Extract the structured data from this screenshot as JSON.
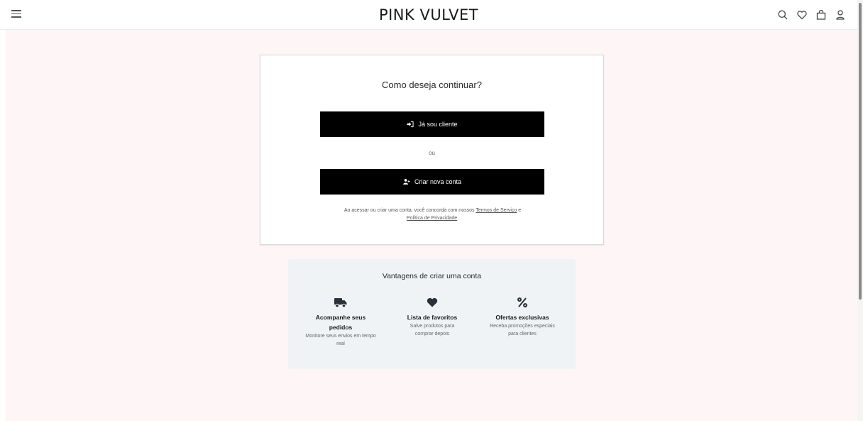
{
  "header": {
    "brand": "PINK VULVET",
    "icons": [
      "menu-icon",
      "search-icon",
      "heart-icon",
      "bag-icon",
      "user-icon"
    ]
  },
  "card": {
    "title": "Como deseja continuar?",
    "login_label": "Já sou cliente",
    "or_text": "ou",
    "create_label": "Criar nova conta",
    "terms_prefix": "Ao acessar ou criar uma conta, você concorda com nossos",
    "terms_link": "Termos de Serviço",
    "terms_and": "e",
    "privacy_link": "Política de Privacidade",
    "terms_end": "."
  },
  "benefits": {
    "title": "Vantagens de criar uma conta",
    "items": [
      {
        "icon": "truck-icon",
        "title": "Acompanhe seus pedidos",
        "desc": "Monitore seus envios em tempo real"
      },
      {
        "icon": "heart-filled-icon",
        "title": "Lista de favoritos",
        "desc": "Salve produtos para comprar depois"
      },
      {
        "icon": "percent-icon",
        "title": "Ofertas exclusivas",
        "desc": "Receba promoções especiais para clientes"
      }
    ]
  },
  "colors": {
    "page_bg": "#fdf5f6",
    "button_bg": "#000000",
    "benefits_bg": "#f0f3f5"
  }
}
